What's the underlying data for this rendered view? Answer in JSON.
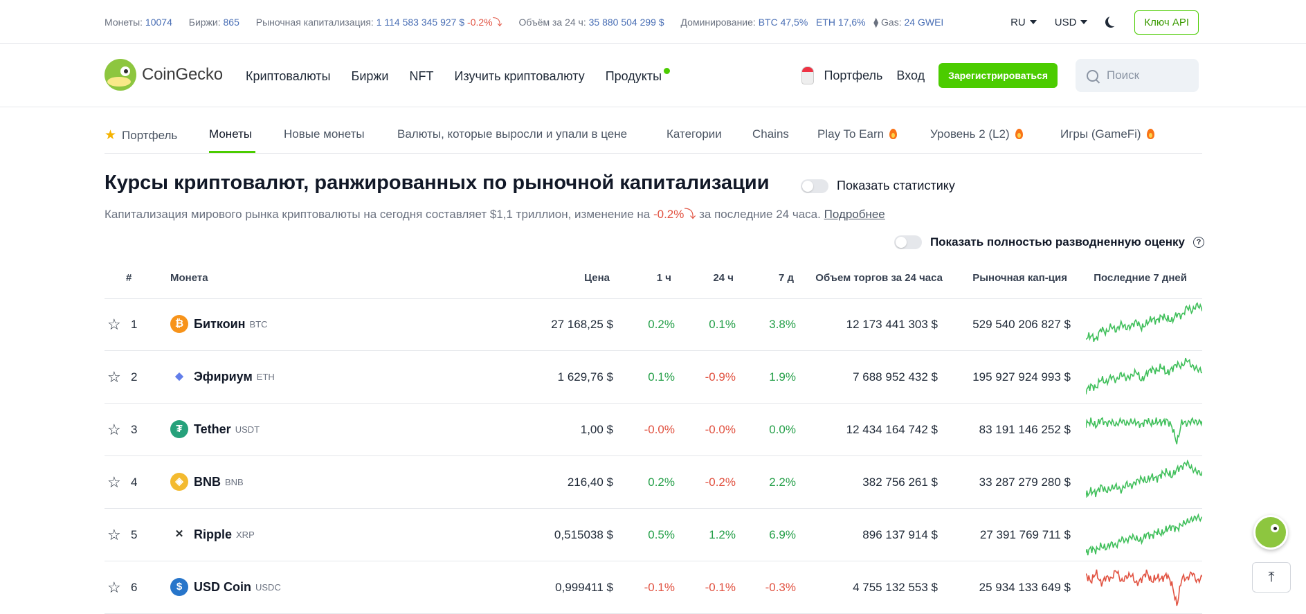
{
  "stats": {
    "coins_label": "Монеты:",
    "coins": "10074",
    "exchanges_label": "Биржи:",
    "exchanges": "865",
    "mcap_label": "Рыночная капитализация:",
    "mcap": "1 114 583 345 927 $",
    "mcap_change": "-0.2%",
    "volume_label": "Объём за 24 ч:",
    "volume": "35 880 504 299 $",
    "dominance_label": "Доминирование:",
    "btc_dom": "BTC 47,5%",
    "eth_dom": "ETH 17,6%",
    "gas_label": "Gas:",
    "gas": "24 GWEI"
  },
  "top_right": {
    "language": "RU",
    "currency": "USD",
    "api_button": "Ключ API"
  },
  "header": {
    "logo_text": "CoinGecko",
    "nav": [
      "Криптовалюты",
      "Биржи",
      "NFT",
      "Изучить криптовалюту",
      "Продукты"
    ],
    "portfolio": "Портфель",
    "login": "Вход",
    "signup": "Зарегистрироваться",
    "search_placeholder": "Поиск"
  },
  "subnav": [
    "Портфель",
    "Монеты",
    "Новые монеты",
    "Валюты, которые выросли и упали в цене",
    "Категории",
    "Chains",
    "Play To Earn",
    "Уровень 2 (L2)",
    "Игры (GameFi)"
  ],
  "page": {
    "title": "Курсы криптовалют, ранжированных по рыночной капитализации",
    "show_stats": "Показать статистику",
    "subtitle_pre": "Капитализация мирового рынка криптовалюты на сегодня составляет $1,1 триллион, изменение на",
    "subtitle_change": "-0.2%",
    "subtitle_post": "за последние 24 часа.",
    "more_link": "Подробнее",
    "diluted_toggle": "Показать полностью разводненную оценку"
  },
  "table": {
    "headers": {
      "rank": "#",
      "coin": "Монета",
      "price": "Цена",
      "h1": "1 ч",
      "h24": "24 ч",
      "d7": "7 д",
      "volume": "Объем торгов за 24 часа",
      "mcap": "Рыночная кап-ция",
      "last7": "Последние 7 дней"
    },
    "rows": [
      {
        "rank": "1",
        "name": "Биткоин",
        "symbol": "BTC",
        "price": "27 168,25 $",
        "h1": "0.2%",
        "h24": "0.1%",
        "d7": "3.8%",
        "volume": "12 173 441 303 $",
        "mcap": "529 540 206 827 $",
        "icon": "bitcoin-icon",
        "color": "#f7931a"
      },
      {
        "rank": "2",
        "name": "Эфириум",
        "symbol": "ETH",
        "price": "1 629,76 $",
        "h1": "0.1%",
        "h24": "-0.9%",
        "d7": "1.9%",
        "volume": "7 688 952 432 $",
        "mcap": "195 927 924 993 $",
        "icon": "ethereum-icon",
        "color": "#627eea"
      },
      {
        "rank": "3",
        "name": "Tether",
        "symbol": "USDT",
        "price": "1,00 $",
        "h1": "-0.0%",
        "h24": "-0.0%",
        "d7": "0.0%",
        "volume": "12 434 164 742 $",
        "mcap": "83 191 146 252 $",
        "icon": "tether-icon",
        "color": "#26a17b"
      },
      {
        "rank": "4",
        "name": "BNB",
        "symbol": "BNB",
        "price": "216,40 $",
        "h1": "0.2%",
        "h24": "-0.2%",
        "d7": "2.2%",
        "volume": "382 756 261 $",
        "mcap": "33 287 279 280 $",
        "icon": "bnb-icon",
        "color": "#f3ba2f"
      },
      {
        "rank": "5",
        "name": "Ripple",
        "symbol": "XRP",
        "price": "0,515038 $",
        "h1": "0.5%",
        "h24": "1.2%",
        "d7": "6.9%",
        "volume": "896 137 914 $",
        "mcap": "27 391 769 711 $",
        "icon": "xrp-icon",
        "color": "#23292f"
      },
      {
        "rank": "6",
        "name": "USD Coin",
        "symbol": "USDC",
        "price": "0,999411 $",
        "h1": "-0.1%",
        "h24": "-0.1%",
        "d7": "-0.3%",
        "volume": "4 755 132 553 $",
        "mcap": "25 934 133 649 $",
        "icon": "usdc-icon",
        "color": "#2775ca"
      }
    ]
  },
  "colors": {
    "accent": "#4bcc00",
    "positive": "#26a04a",
    "negative": "#e15241",
    "link": "#4a6fb5"
  }
}
